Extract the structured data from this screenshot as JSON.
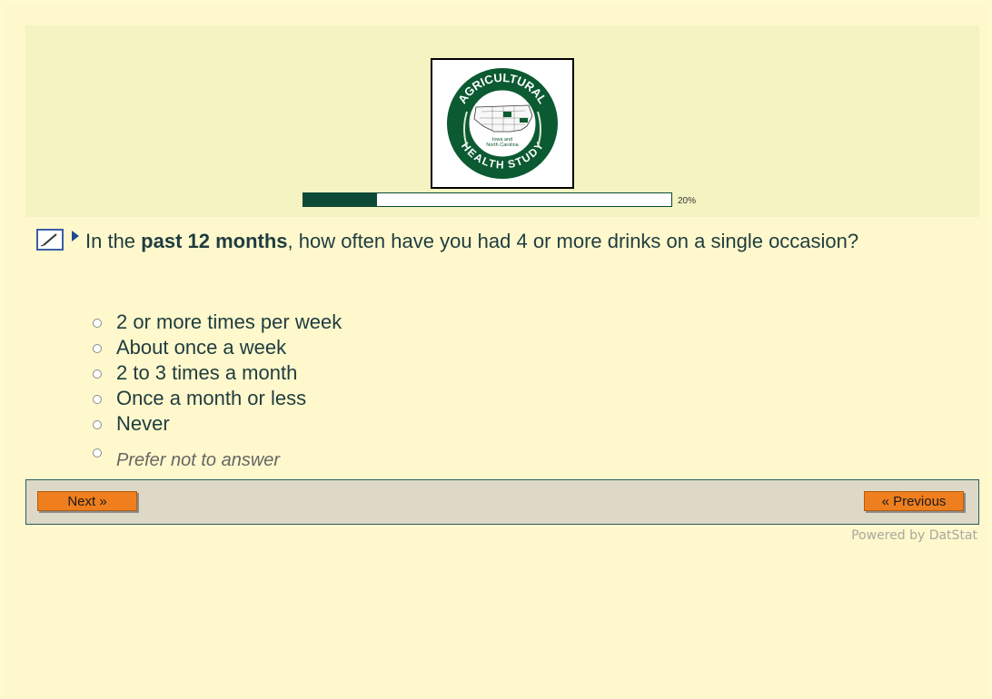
{
  "logo": {
    "top_text": "AGRICULTURAL",
    "bottom_text": "HEALTH STUDY",
    "inner_text_1": "Iowa and",
    "inner_text_2": "North Carolina"
  },
  "progress": {
    "percent": 0.2,
    "label": "20%"
  },
  "question": {
    "prefix": "In the ",
    "emphasis": "past 12 months",
    "suffix": ", how often have you had 4 or more drinks on a single occasion?"
  },
  "options": [
    {
      "label": "2 or more times per week"
    },
    {
      "label": "About once a week"
    },
    {
      "label": "2 to 3 times a month"
    },
    {
      "label": "Once a month or less"
    },
    {
      "label": "Never"
    }
  ],
  "alt_option": {
    "label": "Prefer not to answer"
  },
  "nav": {
    "next_label": "Next »",
    "prev_label": "« Previous"
  },
  "footer": {
    "powered_by": "Powered by DatStat"
  },
  "colors": {
    "brand_green": "#0c4a37",
    "button_orange": "#ef7f1e",
    "text": "#1f3c40"
  }
}
